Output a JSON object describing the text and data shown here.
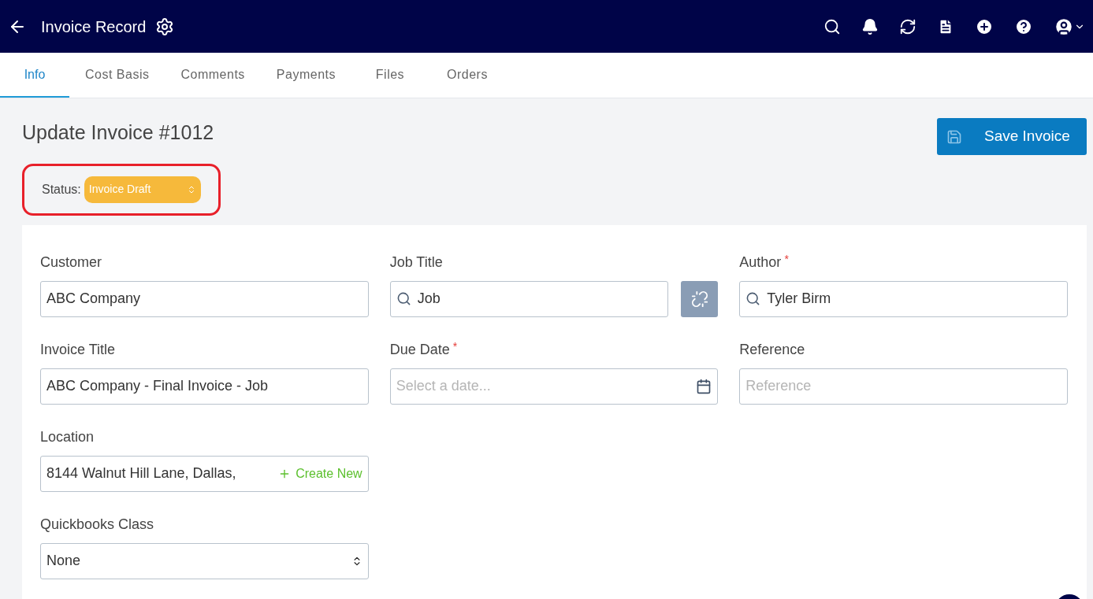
{
  "header": {
    "title": "Invoice Record"
  },
  "tabs": [
    {
      "label": "Info",
      "selected": true
    },
    {
      "label": "Cost Basis",
      "selected": false
    },
    {
      "label": "Comments",
      "selected": false
    },
    {
      "label": "Payments",
      "selected": false
    },
    {
      "label": "Files",
      "selected": false
    },
    {
      "label": "Orders",
      "selected": false
    }
  ],
  "page": {
    "title": "Update Invoice #1012",
    "save_button": "Save Invoice"
  },
  "status": {
    "label": "Status:",
    "value": "Invoice Draft",
    "highlighted": true
  },
  "form_rows": [
    [
      {
        "kind": "text",
        "label": "Customer",
        "value": "ABC Company"
      },
      {
        "kind": "search_link",
        "label": "Job Title",
        "value": "Job"
      },
      {
        "kind": "search",
        "label": "Author",
        "required_mark": "*",
        "value": "Tyler Birm"
      }
    ],
    [
      {
        "kind": "text",
        "label": "Invoice Title",
        "value": "ABC Company - Final Invoice - Job"
      },
      {
        "kind": "date",
        "label": "Due Date",
        "required_mark": "*",
        "placeholder": "Select a date..."
      },
      {
        "kind": "text",
        "label": "Reference",
        "placeholder": "Reference"
      }
    ],
    [
      {
        "kind": "location",
        "label": "Location",
        "value": "8144 Walnut Hill Lane, Dallas,",
        "action": "Create New"
      }
    ],
    [
      {
        "kind": "select",
        "label": "Quickbooks Class",
        "value": "None"
      }
    ]
  ]
}
